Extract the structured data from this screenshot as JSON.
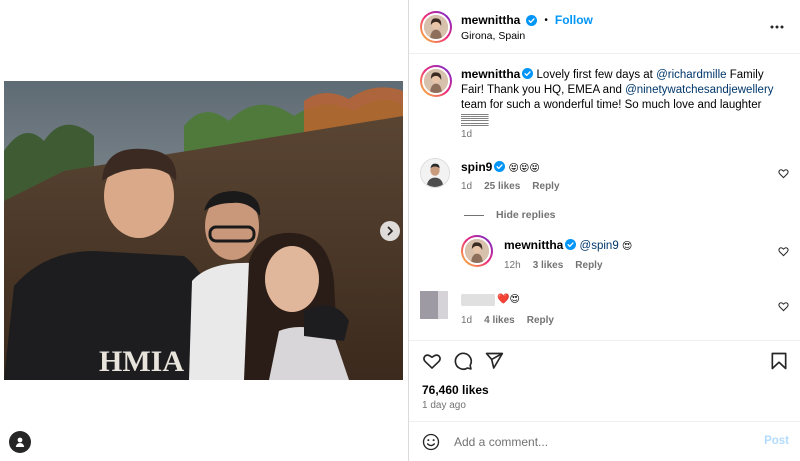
{
  "post": {
    "author": "mewnittha",
    "follow_label": "Follow",
    "separator": "•",
    "location": "Girona, Spain",
    "caption_author": "mewnittha",
    "caption_pre": " Lovely first few days at ",
    "mention1": "@richardmille",
    "caption_mid1": " Family Fair! Thank you HQ, EMEA and ",
    "mention2": "@ninetywatchesandjewellery",
    "caption_post": " team for such a wonderful time! So much love and laughter 𝄛𝄛𝄛",
    "caption_time": "1d"
  },
  "comments": [
    {
      "author": "spin9",
      "text": "😝😝😝",
      "time": "1d",
      "likes": "25 likes",
      "reply_label": "Reply"
    },
    {
      "hide_replies_label": "Hide replies"
    },
    {
      "author": "mewnittha",
      "mention": "@spin9",
      "text": " 😍",
      "time": "12h",
      "likes": "3 likes",
      "reply_label": "Reply"
    },
    {
      "author": "",
      "text": "❤️😍",
      "time": "1d",
      "likes": "4 likes",
      "reply_label": "Reply"
    }
  ],
  "engagement": {
    "likes": "76,460 likes",
    "date": "1 day ago"
  },
  "add_comment": {
    "placeholder": "Add a comment...",
    "post_label": "Post"
  },
  "icons": {
    "like": "heart-icon",
    "comment": "comment-icon",
    "share": "share-icon",
    "save": "bookmark-icon",
    "more": "more-dots-icon",
    "next": "chevron-right-icon",
    "tags": "user-tag-icon",
    "emoji": "emoji-icon",
    "verified": "verified-badge-icon"
  },
  "colors": {
    "accent": "#0095f6",
    "link": "#00376b",
    "muted": "#737373",
    "post_disabled": "#b3dbff",
    "verified": "#0095f6"
  }
}
